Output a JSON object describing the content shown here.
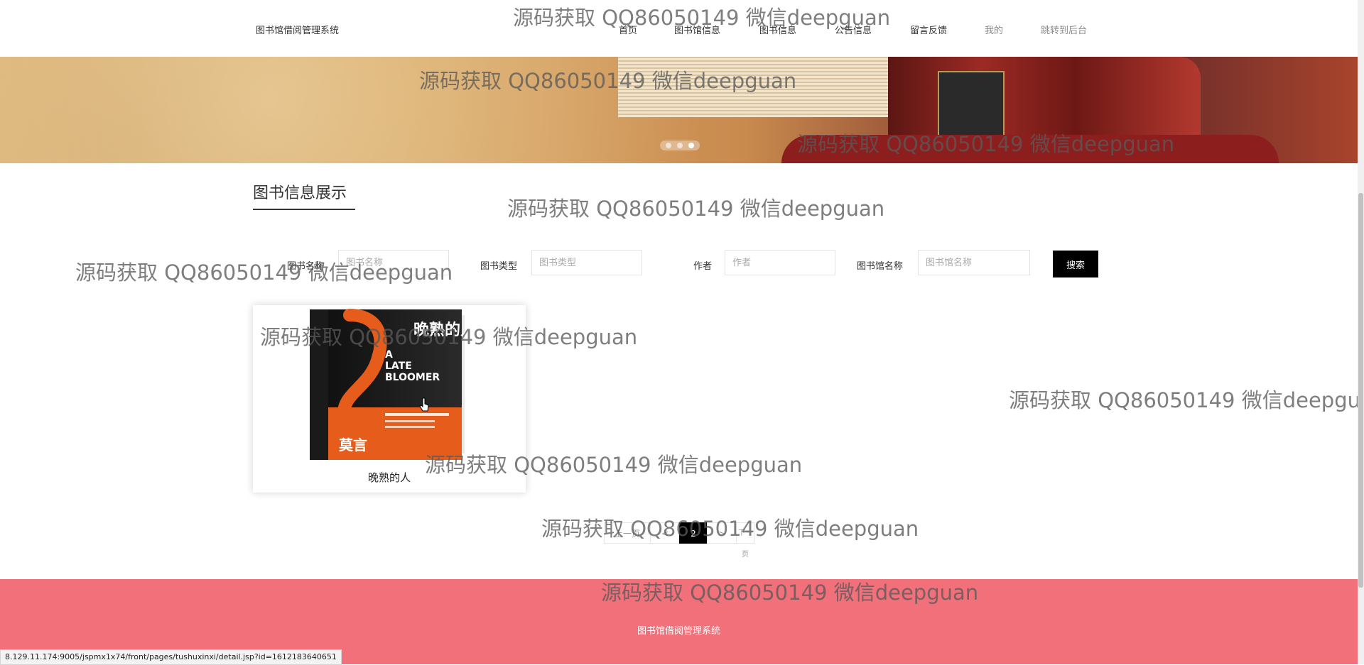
{
  "header": {
    "brand": "图书馆借阅管理系统",
    "nav": [
      "首页",
      "图书馆信息",
      "图书信息",
      "公告信息",
      "留言反馈",
      "我的",
      "跳转到后台"
    ]
  },
  "banner": {
    "active_slide": 3,
    "slide_count": 3
  },
  "section": {
    "title": "图书信息展示"
  },
  "search": {
    "fields": [
      {
        "label": "图书名称",
        "placeholder": "图书名称"
      },
      {
        "label": "图书类型",
        "placeholder": "图书类型"
      },
      {
        "label": "作者",
        "placeholder": "作者"
      },
      {
        "label": "图书馆名称",
        "placeholder": "图书馆名称"
      }
    ],
    "button": "搜索"
  },
  "books": [
    {
      "title": "晚熟的人",
      "cover": {
        "title_cn": "晚熟的人",
        "title_en_1": "A",
        "title_en_2": "LATE",
        "title_en_3": "BLOOMER",
        "author": "莫言"
      }
    }
  ],
  "pagination": {
    "first": "上一页",
    "prev": "<",
    "current": "2",
    "next": ">",
    "last": "下一页"
  },
  "footer": {
    "text": "图书馆借阅管理系统"
  },
  "status_url": "8.129.11.174:9005/jspmx1x74/front/pages/tushuxinxi/detail.jsp?id=1612183640651",
  "watermark": "源码获取 QQ86050149 微信deepguan",
  "colors": {
    "footer": "#f1707a",
    "button": "#000000",
    "accent": "#e65c1b"
  }
}
